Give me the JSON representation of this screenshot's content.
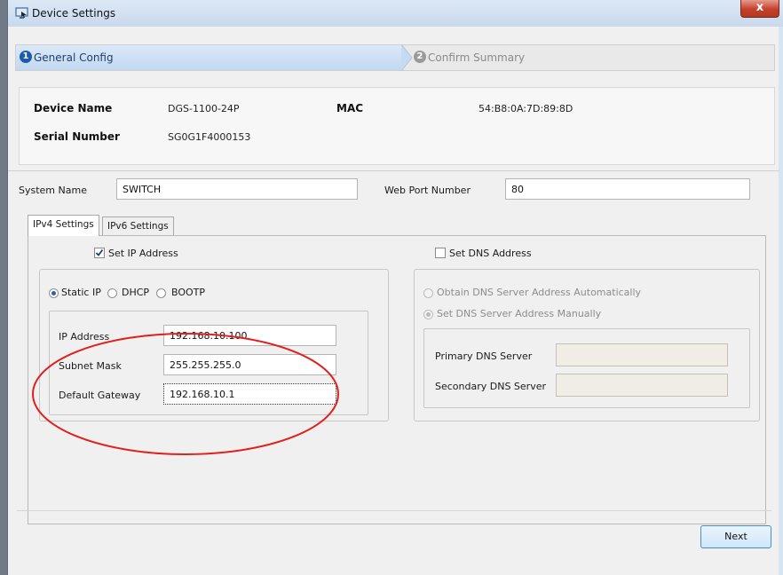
{
  "window": {
    "title": "Device Settings",
    "close_glyph": "x"
  },
  "steps": [
    {
      "number": "1",
      "label": "General Config",
      "state": "active"
    },
    {
      "number": "2",
      "label": "Confirm Summary",
      "state": "pending"
    }
  ],
  "device_info": {
    "device_name_label": "Device Name",
    "device_name_value": "DGS-1100-24P",
    "mac_label": "MAC",
    "mac_value": "54:B8:0A:7D:89:8D",
    "serial_label": "Serial Number",
    "serial_value": "SG0G1F4000153"
  },
  "system": {
    "system_name_label": "System Name",
    "system_name_value": "SWITCH",
    "web_port_label": "Web Port Number",
    "web_port_value": "80"
  },
  "tabs": [
    {
      "label": "IPv4 Settings",
      "active": true
    },
    {
      "label": "IPv6 Settings",
      "active": false
    }
  ],
  "ipv4": {
    "set_ip_label": "Set IP Address",
    "set_ip_checked": true,
    "modes": [
      {
        "label": "Static IP",
        "selected": true
      },
      {
        "label": "DHCP",
        "selected": false
      },
      {
        "label": "BOOTP",
        "selected": false
      }
    ],
    "ip_address_label": "IP Address",
    "ip_address_value": "192.168.10.100",
    "subnet_mask_label": "Subnet Mask",
    "subnet_mask_value": "255.255.255.0",
    "gateway_label": "Default Gateway",
    "gateway_value": "192.168.10.1"
  },
  "dns": {
    "set_dns_label": "Set DNS Address",
    "set_dns_checked": false,
    "auto_label": "Obtain DNS Server Address Automatically",
    "manual_label": "Set DNS Server Address Manually",
    "primary_label": "Primary DNS Server",
    "primary_value": "",
    "secondary_label": "Secondary DNS Server",
    "secondary_value": ""
  },
  "footer": {
    "next_label": "Next"
  },
  "colors": {
    "annotation_circle": "#e0201c",
    "step_active_number": "#1e5aa8",
    "step_pending_number": "#9a9a9a"
  },
  "icons": {
    "window_icon": "monitor-settings-icon",
    "checkmark": "checkmark-icon"
  }
}
